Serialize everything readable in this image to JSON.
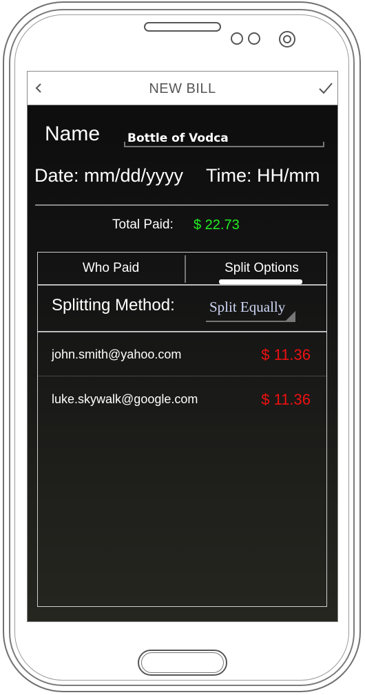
{
  "titlebar": {
    "title": "NEW BILL",
    "back_icon": "chevron-left-icon",
    "confirm_icon": "check-icon"
  },
  "form": {
    "name_label": "Name",
    "name_value": "Bottle of Vodca",
    "date_label": "Date: mm/dd/yyyy",
    "time_label": "Time: HH/mm",
    "total_label": "Total Paid:",
    "total_value": "$ 22.73"
  },
  "tabs": [
    {
      "label": "Who Paid",
      "active": false
    },
    {
      "label": "Split Options",
      "active": true
    }
  ],
  "split": {
    "label": "Splitting Method:",
    "selected": "Split Equally"
  },
  "participants": [
    {
      "email": "john.smith@yahoo.com",
      "amount": "$ 11.36"
    },
    {
      "email": "luke.skywalk@google.com",
      "amount": "$ 11.36"
    }
  ],
  "colors": {
    "total": "#22ee22",
    "amount": "#ee1111",
    "background": "#111111"
  }
}
